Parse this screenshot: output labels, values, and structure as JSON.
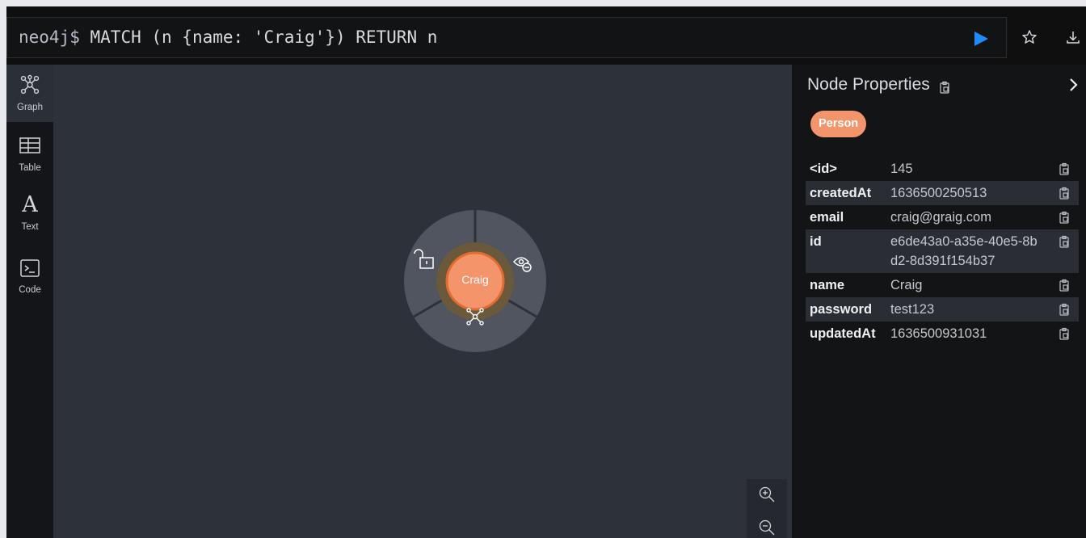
{
  "query_bar": {
    "prompt": "neo4j$",
    "query": "MATCH (n {name: 'Craig'}) RETURN n",
    "run_icon": "play-icon",
    "favorite_icon": "star-icon",
    "download_icon": "download-icon"
  },
  "left_nav": {
    "items": [
      {
        "label": "Graph",
        "icon": "graph-icon",
        "active": true
      },
      {
        "label": "Table",
        "icon": "table-icon",
        "active": false
      },
      {
        "label": "Text",
        "icon_glyph": "A",
        "active": false
      },
      {
        "label": "Code",
        "icon": "terminal-icon",
        "active": false
      }
    ]
  },
  "graph": {
    "node": {
      "caption": "Craig",
      "color": "#f4946a"
    },
    "ring_actions": [
      "unlock-icon",
      "hide-icon",
      "expand-graph-icon"
    ],
    "zoom": [
      "zoom-in-icon",
      "zoom-out-icon"
    ]
  },
  "properties": {
    "title": "Node Properties",
    "label": "Person",
    "label_color": "#f4946a",
    "rows": [
      {
        "key": "<id>",
        "value": "145"
      },
      {
        "key": "createdAt",
        "value": "1636500250513"
      },
      {
        "key": "email",
        "value": "craig@graig.com"
      },
      {
        "key": "id",
        "value": "e6de43a0-a35e-40e5-8bd2-8d391f154b37"
      },
      {
        "key": "name",
        "value": "Craig"
      },
      {
        "key": "password",
        "value": "test123"
      },
      {
        "key": "updatedAt",
        "value": "1636500931031"
      }
    ]
  },
  "colors": {
    "accent": "#1f8bff",
    "canvas": "#2d3139",
    "panel": "#131416"
  }
}
